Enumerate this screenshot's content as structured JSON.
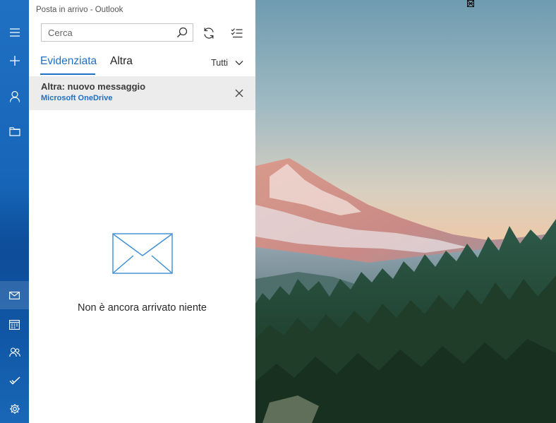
{
  "window": {
    "title": "Posta in arrivo - Outlook"
  },
  "search": {
    "placeholder": "Cerca"
  },
  "tabs": [
    {
      "label": "Evidenziata",
      "active": true
    },
    {
      "label": "Altra",
      "active": false
    }
  ],
  "filter": {
    "label": "Tutti"
  },
  "notice": {
    "title": "Altra: nuovo messaggio",
    "sender": "Microsoft OneDrive"
  },
  "empty_state": {
    "message": "Non è ancora arrivato niente"
  },
  "icons": {
    "rail_top": [
      "menu-icon",
      "compose-plus-icon",
      "account-icon",
      "folder-icon"
    ],
    "rail_bottom": [
      "mail-icon",
      "calendar-icon",
      "people-icon",
      "todo-icon",
      "settings-icon"
    ],
    "toolbar": [
      "search-icon",
      "sync-icon",
      "select-mode-icon"
    ],
    "window": [
      "minimize-icon",
      "maximize-icon",
      "close-icon"
    ]
  },
  "colors": {
    "accent": "#1f6fc3",
    "rail": "#1766ba",
    "notice_bg": "#ececec"
  }
}
